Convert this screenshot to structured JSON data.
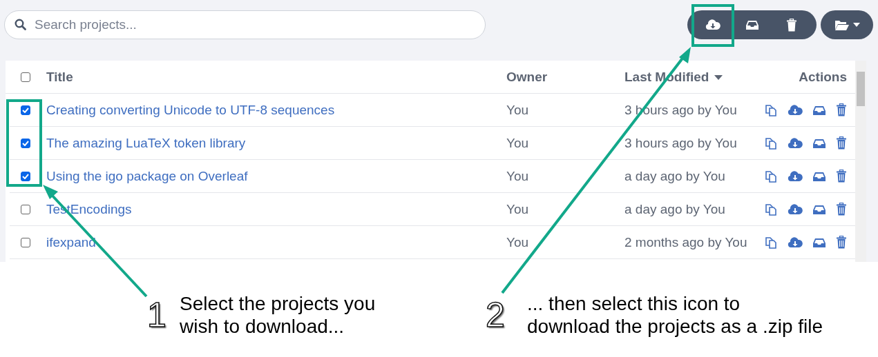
{
  "search": {
    "placeholder": "Search projects..."
  },
  "table": {
    "select_all": {
      "checked": false
    },
    "columns": [
      {
        "label": "Title",
        "sorted": false
      },
      {
        "label": "Owner",
        "sorted": false
      },
      {
        "label": "Last Modified",
        "sorted": true
      },
      {
        "label": "Actions",
        "sorted": false
      }
    ],
    "rows": [
      {
        "checked": true,
        "title": "Creating converting Unicode to UTF-8 sequences",
        "owner": "You",
        "modified": "3 hours ago by You"
      },
      {
        "checked": true,
        "title": "The amazing LuaTeX token library",
        "owner": "You",
        "modified": "3 hours ago by You"
      },
      {
        "checked": true,
        "title": "Using the igo package on Overleaf",
        "owner": "You",
        "modified": "a day ago by You"
      },
      {
        "checked": false,
        "title": "TestEncodings",
        "owner": "You",
        "modified": "a day ago by You"
      },
      {
        "checked": false,
        "title": "ifexpand",
        "owner": "You",
        "modified": "2 months ago by You"
      }
    ]
  },
  "callouts": [
    {
      "number": "1",
      "text": "Select the projects you\nwish to download..."
    },
    {
      "number": "2",
      "text": "... then select this icon to\ndownload the projects as a .zip file"
    }
  ]
}
